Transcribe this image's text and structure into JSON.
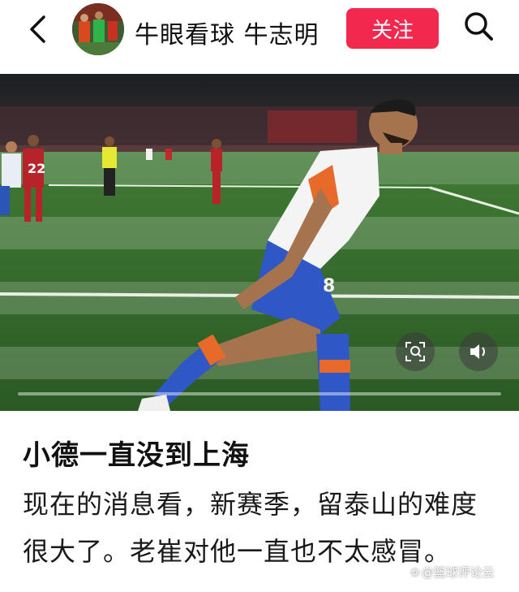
{
  "header": {
    "author_name": "牛眼看球 牛志明",
    "follow_label": "关注",
    "back_icon": "chevron-left-icon",
    "search_icon": "search-icon"
  },
  "media": {
    "player_number": "22",
    "shirt_number": "8",
    "progress_fraction": 0.0,
    "controls": [
      "screen-capture-icon",
      "volume-icon"
    ]
  },
  "article": {
    "title": "小德一直没到上海",
    "body": "现在的消息看，新赛季，留泰山的难度很大了。老崔对他一直也不太感冒。"
  },
  "watermark": {
    "text": "@篮球评论云"
  },
  "colors": {
    "follow": "#f2284f",
    "pitch": "#3a6b33"
  }
}
